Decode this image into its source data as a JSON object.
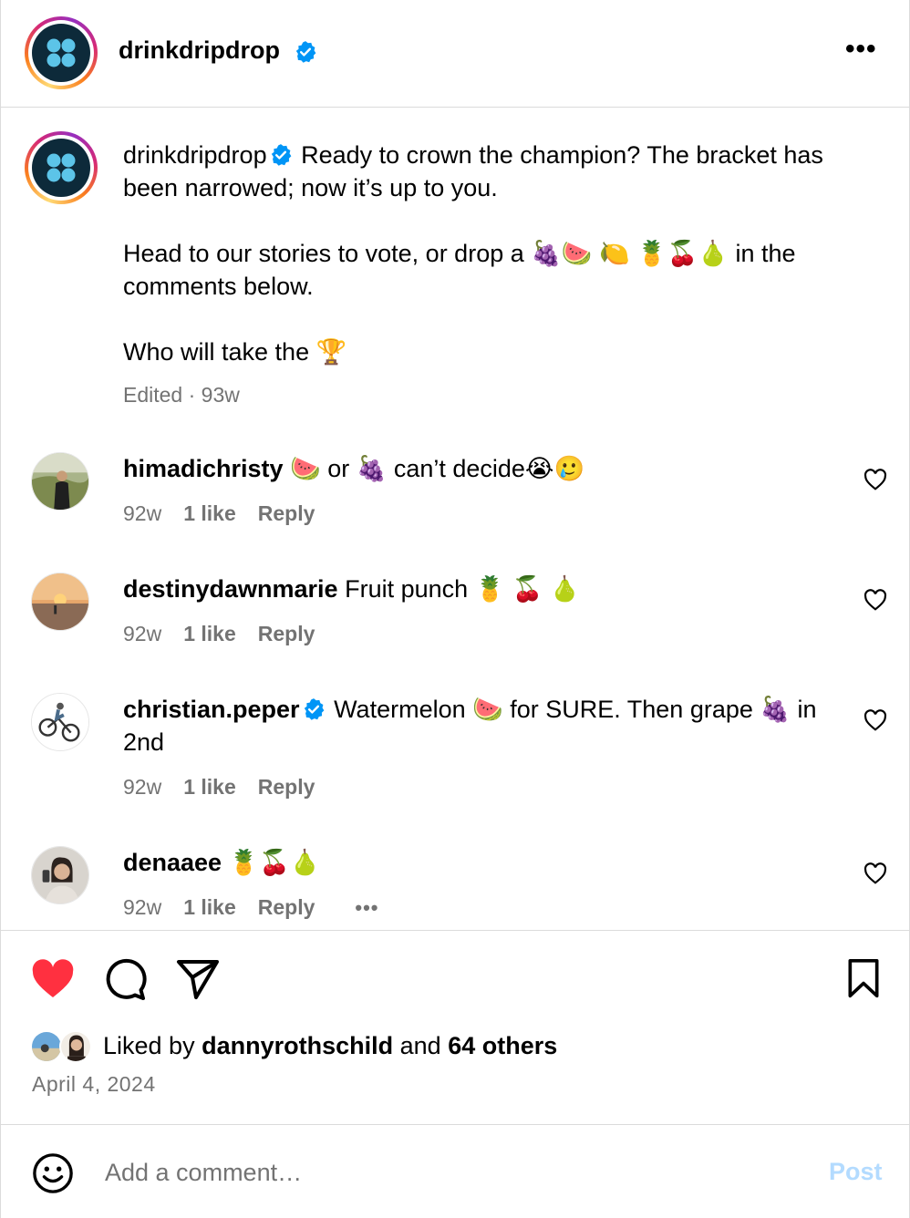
{
  "post": {
    "author": "drinkdripdrop",
    "verified": true
  },
  "caption": {
    "username": "drinkdripdrop",
    "line1": "Ready to crown the champion? The bracket has been narrowed; now it’s up to you.",
    "line2": "Head to our stories to vote, or drop a 🍇🍉 🍋 🍍🍒🍐 in the comments below.",
    "line3": "Who will take the 🏆",
    "edited": "Edited",
    "age": "93w"
  },
  "comments": [
    {
      "username": "himadichristy",
      "verified": false,
      "text": "🍉 or 🍇 can’t decide😭🥲",
      "age": "92w",
      "likes": "1 like",
      "reply": "Reply"
    },
    {
      "username": "destinydawnmarie",
      "verified": false,
      "text": "Fruit punch 🍍 🍒 🍐",
      "age": "92w",
      "likes": "1 like",
      "reply": "Reply"
    },
    {
      "username": "christian.peper",
      "verified": true,
      "text": "Watermelon 🍉 for SURE. Then grape 🍇 in 2nd",
      "age": "92w",
      "likes": "1 like",
      "reply": "Reply"
    },
    {
      "username": "denaaee",
      "verified": false,
      "text": "🍍🍒🍐",
      "age": "92w",
      "likes": "1 like",
      "reply": "Reply"
    }
  ],
  "likes": {
    "prefix": "Liked by",
    "user": "dannyrothschild",
    "and": "and",
    "others": "64 others"
  },
  "date": "April 4, 2024",
  "composer": {
    "placeholder": "Add a comment…",
    "post_label": "Post"
  },
  "colors": {
    "like_red": "#ff3040",
    "verified_blue": "#0095f6",
    "muted_text": "#737373",
    "post_disabled": "#b3dbff"
  },
  "icons": {
    "like": "heart-filled-icon",
    "comment": "comment-icon",
    "share": "paper-plane-icon",
    "save": "bookmark-icon",
    "emoji": "smiley-icon",
    "more": "ellipsis-icon"
  }
}
